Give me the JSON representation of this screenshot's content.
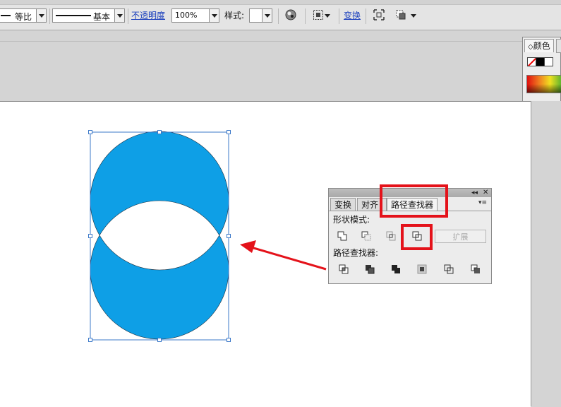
{
  "controlbar": {
    "scale_label": "等比",
    "stroke_profile_label": "基本",
    "opacity_label": "不透明度",
    "opacity_value": "100%",
    "style_label": "样式:",
    "transform_link": "变换"
  },
  "color_panel": {
    "tab_label": "颜色",
    "tab_arrow": "◇"
  },
  "pathfinder_panel": {
    "tabs": [
      "变换",
      "对齐",
      "路径查找器"
    ],
    "active_tab": "路径查找器",
    "shape_modes_label": "形状模式:",
    "pathfinders_label": "路径查找器:",
    "expand_label": "扩展",
    "shape_mode_buttons": [
      "unite-icon",
      "minus-front-icon",
      "intersect-icon",
      "exclude-icon"
    ],
    "pathfinder_buttons": [
      "divide-icon",
      "trim-icon",
      "merge-icon",
      "crop-icon",
      "outline-icon",
      "minus-back-icon"
    ],
    "collapse_glyph": "◂◂",
    "close_glyph": "✕",
    "menu_glyph": "▾≡"
  },
  "artwork": {
    "fill_color": "#0e9fe6",
    "selection_color": "#3b78c8"
  },
  "annotations": {
    "highlight_color": "#e4121a",
    "arrow_color": "#e4121a"
  }
}
